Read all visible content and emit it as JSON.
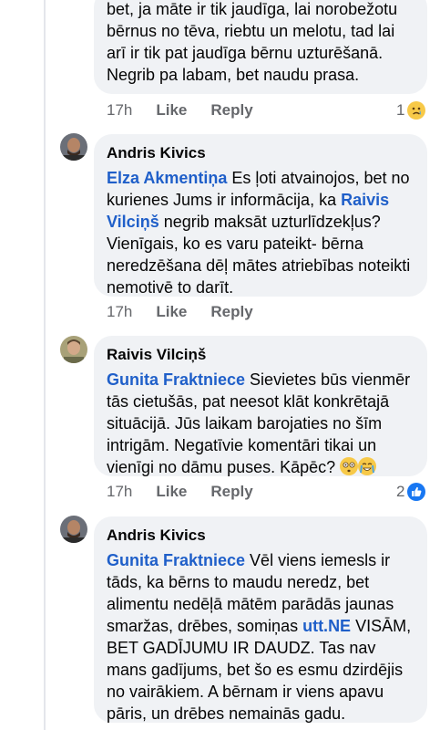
{
  "comments": [
    {
      "lines": [
        "bet, ja māte ir tik jaudīga, lai norobežotu",
        "bērnus no tēva, riebtu un melotu, tad lai",
        "arī ir tik pat jaudīga bērnu uzturēšanā.",
        "Negrib pa labam, bet naudu prasa."
      ],
      "time": "17h",
      "like": "Like",
      "reply": "Reply",
      "reaction_count": "1"
    },
    {
      "author": "Andris Kivics",
      "mention1": "Elza Akmentiņa",
      "t1": " Es ļoti atvainojos, bet no kurienes Jums ir informācija, ka ",
      "mention2": "Raivis Vilciņš",
      "t2": " negrib maksāt uzturlīdzekļus? Vienīgais, ko es varu pateikt- bērna neredzēšana dēļ mātes atriebības noteikti nemotivē to darīt.",
      "time": "17h",
      "like": "Like",
      "reply": "Reply"
    },
    {
      "author": "Raivis Vilciņš",
      "mention1": "Gunita Fraktniece",
      "t1": " Sievietes būs vienmēr tās cietušās, pat neesot klāt konkrētajā situācijā. Jūs laikam barojaties no šīm intrigām. Negatīvie komentāri tikai un vienīgi no dāmu puses. Kāpēc?",
      "time": "17h",
      "like": "Like",
      "reply": "Reply",
      "reaction_count": "2"
    },
    {
      "author": "Andris Kivics",
      "mention1": "Gunita Fraktniece",
      "t1": " Vēl viens iemesls ir tāds, ka bērns to maudu neredz, bet alimentu nedēļā mātēm parādās jaunas smaržas, drēbes, somiņas ",
      "link": "utt.NE",
      "t2": " VISĀM, BET GADĪJUMU IR DAUDZ. Tas nav mans gadījums, bet šo es esmu dzirdējis no vairākiem. A bērnam ir viens apavu pāris, un drēbes nemainās gadu."
    }
  ]
}
